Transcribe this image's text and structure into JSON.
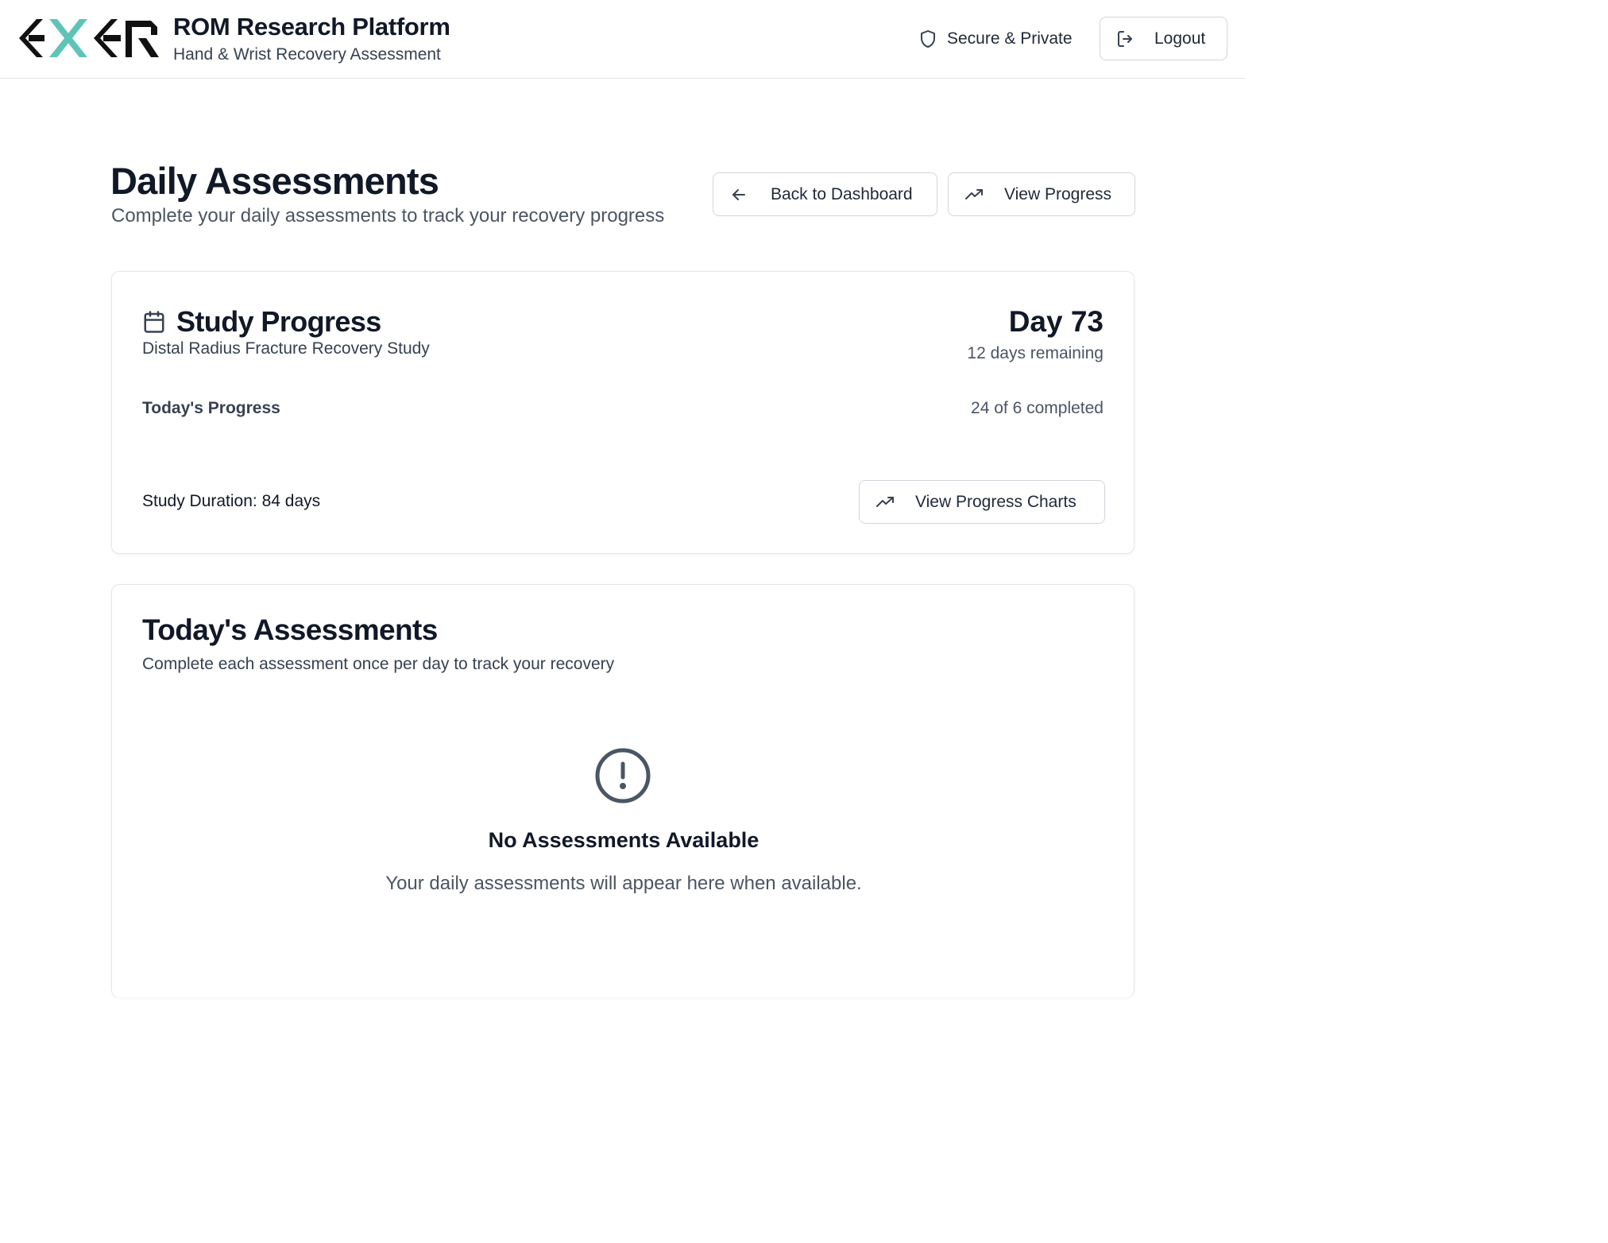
{
  "header": {
    "logo_name": "exer-logo",
    "title": "ROM Research Platform",
    "subtitle": "Hand & Wrist Recovery Assessment",
    "secure_label": "Secure & Private",
    "logout_label": "Logout"
  },
  "page": {
    "title": "Daily Assessments",
    "subtitle": "Complete your daily assessments to track your recovery progress",
    "back_label": "Back to Dashboard",
    "progress_label": "View Progress"
  },
  "study": {
    "title": "Study Progress",
    "subtitle": "Distal Radius Fracture Recovery Study",
    "day": "Day 73",
    "remaining": "12 days remaining",
    "today_label": "Today's Progress",
    "completed_text": "24 of 6 completed",
    "duration": "Study Duration: 84 days",
    "charts_label": "View Progress Charts"
  },
  "today": {
    "title": "Today's Assessments",
    "subtitle": "Complete each assessment once per day to track your recovery",
    "empty_title": "No Assessments Available",
    "empty_subtitle": "Your daily assessments will appear here when available."
  },
  "colors": {
    "accent_teal": "#5fc4b8",
    "text_dark": "#111827",
    "border": "#d1d5db"
  }
}
